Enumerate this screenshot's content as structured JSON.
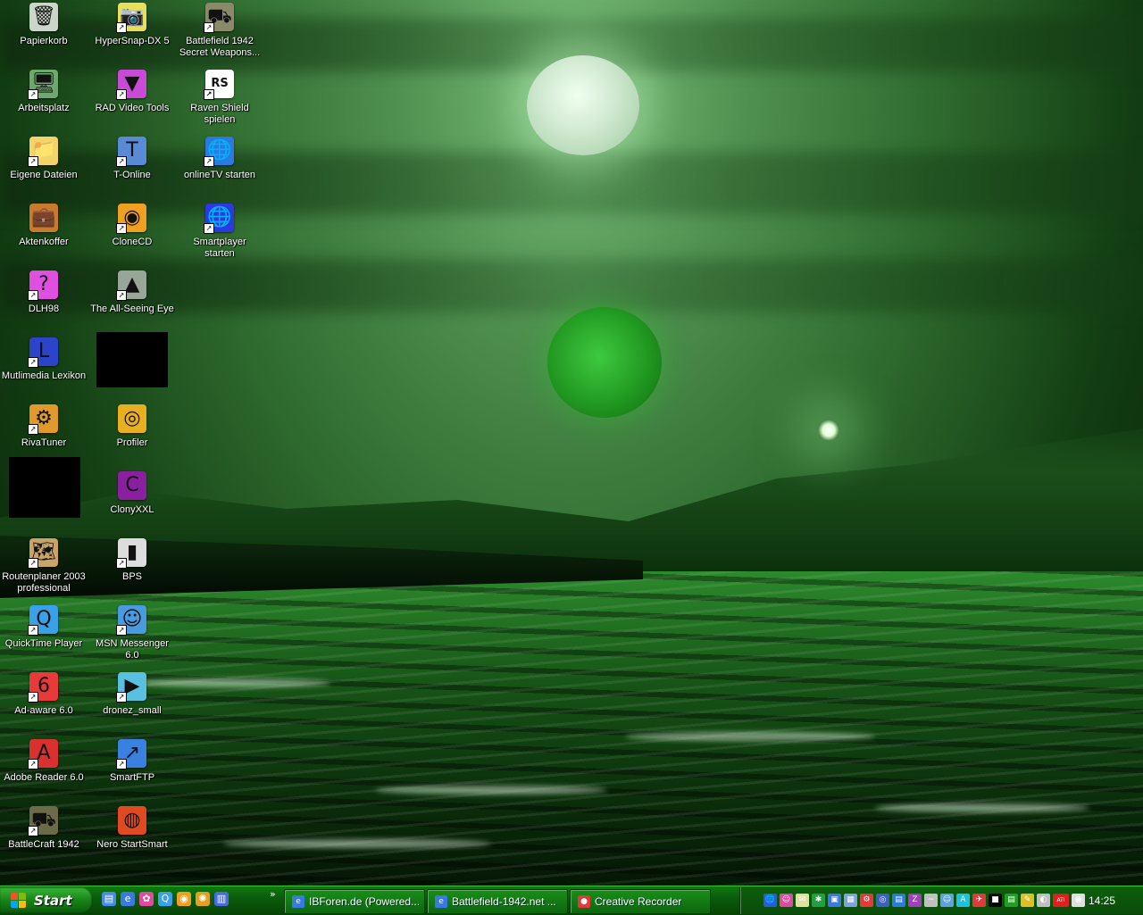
{
  "desktop": {
    "icons": [
      {
        "label": "Papierkorb",
        "glyph": "🗑",
        "color": "#c9d6c9",
        "shortcut": false
      },
      {
        "label": "Arbeitsplatz",
        "glyph": "🖥",
        "color": "#6fa86f",
        "shortcut": true
      },
      {
        "label": "Eigene Dateien",
        "glyph": "📁",
        "color": "#f2d46a",
        "shortcut": true
      },
      {
        "label": "Aktenkoffer",
        "glyph": "💼",
        "color": "#c97a2b",
        "shortcut": false
      },
      {
        "label": "DLH98",
        "glyph": "?",
        "color": "#e04fe0",
        "shortcut": true
      },
      {
        "label": "Mutlimedia Lexikon",
        "glyph": "L",
        "color": "#2b44c9",
        "shortcut": true
      },
      {
        "label": "RivaTuner",
        "glyph": "⚙",
        "color": "#e09a2b",
        "shortcut": true
      },
      {
        "label": "Routenplaner 2003\nprofessional",
        "glyph": "🗺",
        "color": "#c9a46a",
        "shortcut": true
      },
      {
        "label": "QuickTime Player",
        "glyph": "Q",
        "color": "#3aa0e8",
        "shortcut": true
      },
      {
        "label": "Ad-aware 6.0",
        "glyph": "6",
        "color": "#e83a3a",
        "shortcut": true
      },
      {
        "label": "Adobe Reader 6.0",
        "glyph": "A",
        "color": "#d93030",
        "shortcut": true
      },
      {
        "label": "BattleCraft 1942",
        "glyph": "⛟",
        "color": "#6b6b4a",
        "shortcut": true
      },
      {
        "label": "HyperSnap-DX 5",
        "glyph": "📷",
        "color": "#e8e05a",
        "shortcut": true
      },
      {
        "label": "RAD Video Tools",
        "glyph": "▼",
        "color": "#c94ad6",
        "shortcut": true
      },
      {
        "label": "T-Online",
        "glyph": "T",
        "color": "#5a8ad6",
        "shortcut": true
      },
      {
        "label": "CloneCD",
        "glyph": "◉",
        "color": "#f0a020",
        "shortcut": true
      },
      {
        "label": "The All-Seeing Eye",
        "glyph": "▲",
        "color": "#9aa59a",
        "shortcut": true
      },
      {
        "label": "Profiler",
        "glyph": "◎",
        "color": "#e8b020",
        "shortcut": false
      },
      {
        "label": "ClonyXXL",
        "glyph": "C",
        "color": "#8a20a0",
        "shortcut": false
      },
      {
        "label": "BPS",
        "glyph": "▮",
        "color": "#dddddd",
        "shortcut": true
      },
      {
        "label": "MSN Messenger 6.0",
        "glyph": "☺",
        "color": "#4a9ae0",
        "shortcut": true
      },
      {
        "label": "dronez_small",
        "glyph": "▶",
        "color": "#5ac0e0",
        "shortcut": true
      },
      {
        "label": "SmartFTP",
        "glyph": "↗",
        "color": "#3a80e0",
        "shortcut": true
      },
      {
        "label": "Nero StartSmart",
        "glyph": "◍",
        "color": "#e04a20",
        "shortcut": false
      },
      {
        "label": "Battlefield 1942\nSecret Weapons...",
        "glyph": "⛟",
        "color": "#8a8a6a",
        "shortcut": true
      },
      {
        "label": "Raven Shield\nspielen",
        "glyph": "RS",
        "color": "#ffffff",
        "shortcut": true
      },
      {
        "label": "onlineTV starten",
        "glyph": "🌐",
        "color": "#2a7ae0",
        "shortcut": true
      },
      {
        "label": "Smartplayer\nstarten",
        "glyph": "🌐",
        "color": "#2a3ae0",
        "shortcut": true
      }
    ]
  },
  "taskbar": {
    "start_label": "Start",
    "quicklaunch": [
      {
        "glyph": "▤",
        "color": "#4a8ae0"
      },
      {
        "glyph": "e",
        "color": "#3a7ae0"
      },
      {
        "glyph": "✿",
        "color": "#e04aa0"
      },
      {
        "glyph": "Q",
        "color": "#3aa0e8"
      },
      {
        "glyph": "◉",
        "color": "#f0a020"
      },
      {
        "glyph": "✺",
        "color": "#e0a020"
      },
      {
        "glyph": "▥",
        "color": "#4a6ae0"
      }
    ],
    "quicklaunch_more": "»",
    "tasks": [
      {
        "label": "IBForen.de (Powered...",
        "glyph": "e",
        "color": "#3a7ae0"
      },
      {
        "label": "Battlefield-1942.net ...",
        "glyph": "e",
        "color": "#3a7ae0"
      },
      {
        "label": "Creative Recorder",
        "glyph": "●",
        "color": "#e03a3a"
      }
    ],
    "tray_icons": [
      {
        "glyph": "🌐",
        "color": "#2a5ae0"
      },
      {
        "glyph": "☺",
        "color": "#e04aa0"
      },
      {
        "glyph": "✉",
        "color": "#e0e0a0"
      },
      {
        "glyph": "✱",
        "color": "#20a040"
      },
      {
        "glyph": "▣",
        "color": "#3a7ae0"
      },
      {
        "glyph": "▦",
        "color": "#80a0e0"
      },
      {
        "glyph": "⚙",
        "color": "#e03a3a"
      },
      {
        "glyph": "◎",
        "color": "#3a60c0"
      },
      {
        "glyph": "▤",
        "color": "#2a7ae0"
      },
      {
        "glyph": "Z",
        "color": "#a040c0"
      },
      {
        "glyph": "~",
        "color": "#c0c0c0"
      },
      {
        "glyph": "☺",
        "color": "#60a0e0"
      },
      {
        "glyph": "A",
        "color": "#20c0e0"
      },
      {
        "glyph": "✈",
        "color": "#e03a3a"
      },
      {
        "glyph": "■",
        "color": "#000000"
      },
      {
        "glyph": "▤",
        "color": "#20a020"
      },
      {
        "glyph": "✎",
        "color": "#e0c020"
      },
      {
        "glyph": "◐",
        "color": "#c0c0c0"
      },
      {
        "glyph": "ATI",
        "color": "#e02020"
      },
      {
        "glyph": "◉",
        "color": "#e0e0e0"
      }
    ],
    "clock": "14:25"
  }
}
